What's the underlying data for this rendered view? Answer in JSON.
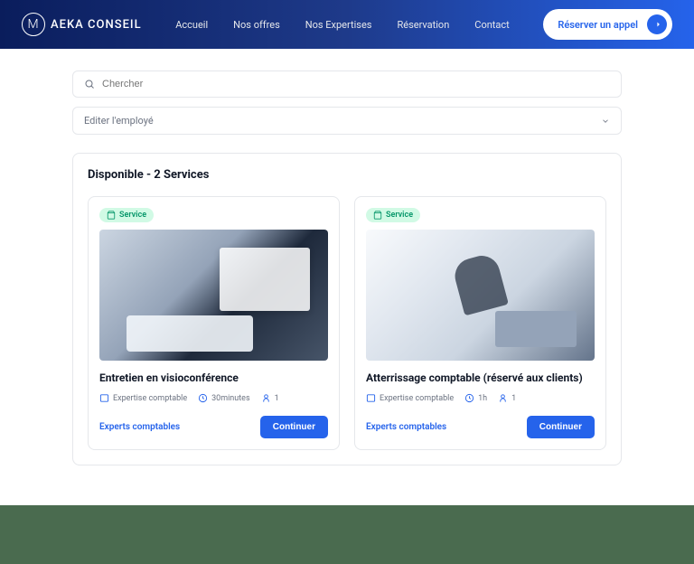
{
  "header": {
    "logo_text": "AEKA CONSEIL",
    "nav": [
      "Accueil",
      "Nos offres",
      "Nos Expertises",
      "Réservation",
      "Contact"
    ],
    "cta": "Réserver un appel"
  },
  "search": {
    "placeholder": "Chercher"
  },
  "employee_select": {
    "label": "Editer l'employé"
  },
  "panel": {
    "title": "Disponible - 2 Services",
    "badge_label": "Service",
    "continue_label": "Continuer",
    "link_label": "Experts comptables",
    "services": [
      {
        "title": "Entretien en visioconférence",
        "category": "Expertise comptable",
        "duration": "30minutes",
        "capacity": "1"
      },
      {
        "title": "Atterrissage comptable (réservé aux clients)",
        "category": "Expertise comptable",
        "duration": "1h",
        "capacity": "1"
      }
    ]
  }
}
